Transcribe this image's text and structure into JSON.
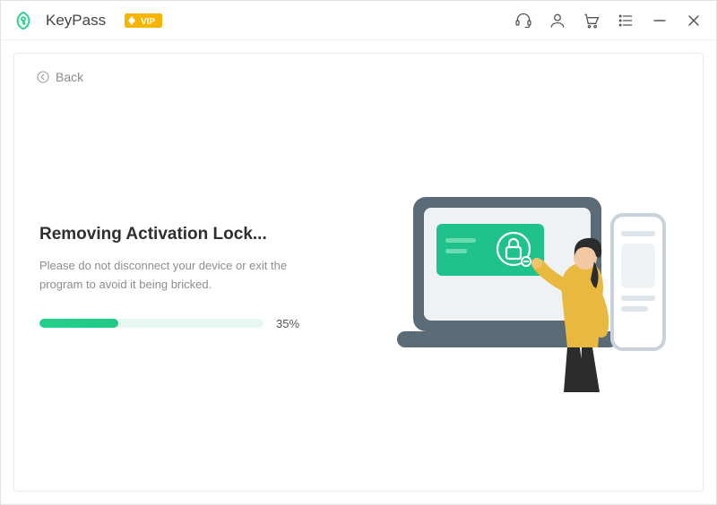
{
  "header": {
    "app_name": "KeyPass",
    "vip_label": "VIP"
  },
  "back": {
    "label": "Back"
  },
  "progress": {
    "heading": "Removing Activation Lock...",
    "subtext": "Please do not disconnect your device or exit the program to avoid it being bricked.",
    "percent_label": "35%",
    "percent_value": 35
  },
  "icons": {
    "logo": "app-logo",
    "vip": "vip-badge",
    "support": "headset-icon",
    "user": "user-icon",
    "cart": "cart-icon",
    "menu": "menu-icon",
    "minimize": "minimize-icon",
    "close": "close-icon",
    "back": "back-chevron-icon"
  },
  "colors": {
    "accent": "#24cf8d",
    "vip_orange": "#f7b500",
    "muted": "#8d8d8d",
    "bar_track": "#e8f7f1"
  }
}
